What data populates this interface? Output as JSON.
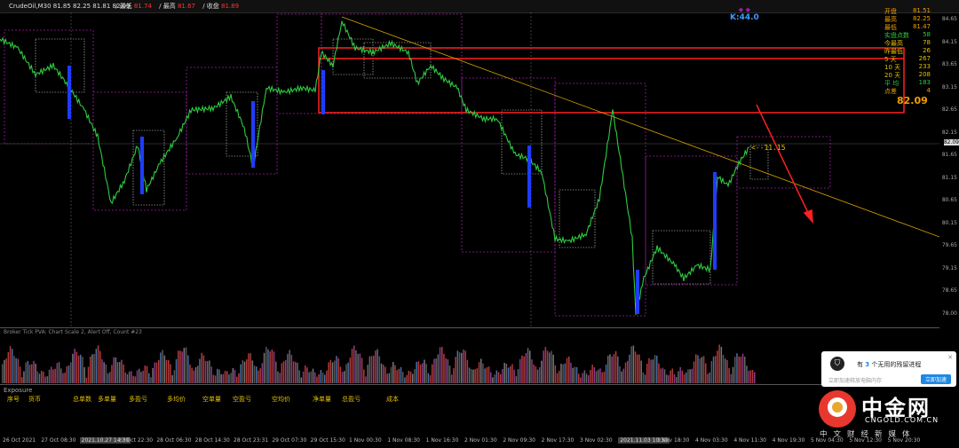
{
  "topbar": {
    "symbol": "CrudeOil,M30  81.85 82.25 81.81 82.09",
    "o_label": "/ 最低",
    "o_val": "81.74",
    "h_label": "/ 最高",
    "h_val": "81.67",
    "c_label": "/ 收盘",
    "c_val": "81.89"
  },
  "k_label": "K:44.0",
  "current_price_label": "82.09",
  "price_arrow_label": "<--11.15",
  "info_panel": {
    "rows": [
      {
        "label": "开盘",
        "value": "81.51",
        "color": "#f0a000"
      },
      {
        "label": "最高",
        "value": "82.25",
        "color": "#f0a000"
      },
      {
        "label": "最低",
        "value": "81.47",
        "color": "#f0a000"
      },
      {
        "label": "实盘点数",
        "value": "58",
        "color": "#2ecc40"
      },
      {
        "label": "今最高",
        "value": "78",
        "color": "#e5c100"
      },
      {
        "label": "昨最低",
        "value": "26",
        "color": "#e5c100"
      },
      {
        "label": "5  天",
        "value": "267",
        "color": "#e5c100"
      },
      {
        "label": "10 天",
        "value": "233",
        "color": "#e5c100"
      },
      {
        "label": "20 天",
        "value": "208",
        "color": "#e5c100"
      },
      {
        "label": "平  均",
        "value": "183",
        "color": "#2ecc40"
      },
      {
        "label": "点差",
        "value": "4",
        "color": "#f0a000"
      }
    ],
    "big_price": "82.09"
  },
  "price_axis": [
    "84.65",
    "84.15",
    "83.65",
    "83.15",
    "82.65",
    "82.15",
    "81.65",
    "81.15",
    "80.65",
    "80.15",
    "79.65",
    "79.15",
    "78.65",
    "78.00"
  ],
  "volume_label": "Broker Tick PVA:   Chart Scale  2, Alert Off,  Count  #23",
  "exposure": {
    "title": "Exposure",
    "columns": [
      "序号",
      "货币",
      "总单数",
      "多单量",
      "多盈亏",
      "多均价",
      "空单量",
      "空盈亏",
      "空均价",
      "净单量",
      "总盈亏",
      "成本"
    ]
  },
  "time_axis": [
    {
      "t": "26 Oct 2021",
      "hl": false
    },
    {
      "t": "27 Oct 08:30",
      "hl": false
    },
    {
      "t": "2021.10.27 14:30",
      "hl": true
    },
    {
      "t": "27 Oct 22:30",
      "hl": false
    },
    {
      "t": "28 Oct 06:30",
      "hl": false
    },
    {
      "t": "28 Oct 14:30",
      "hl": false
    },
    {
      "t": "28 Oct 23:31",
      "hl": false
    },
    {
      "t": "29 Oct 07:30",
      "hl": false
    },
    {
      "t": "29 Oct 15:30",
      "hl": false
    },
    {
      "t": "1 Nov 00:30",
      "hl": false
    },
    {
      "t": "1 Nov 08:30",
      "hl": false
    },
    {
      "t": "1 Nov 16:30",
      "hl": false
    },
    {
      "t": "2 Nov 01:30",
      "hl": false
    },
    {
      "t": "2 Nov 09:30",
      "hl": false
    },
    {
      "t": "2 Nov 17:30",
      "hl": false
    },
    {
      "t": "3 Nov 02:30",
      "hl": false
    },
    {
      "t": "2021.11.03 10:30",
      "hl": true
    },
    {
      "t": "3 Nov 18:30",
      "hl": false
    },
    {
      "t": "4 Nov 03:30",
      "hl": false
    },
    {
      "t": "4 Nov 11:30",
      "hl": false
    },
    {
      "t": "4 Nov 19:30",
      "hl": false
    },
    {
      "t": "5 Nov 04:30",
      "hl": false
    },
    {
      "t": "5 Nov 12:30",
      "hl": false
    },
    {
      "t": "5 Nov 20:30",
      "hl": false
    }
  ],
  "notification": {
    "msg_pre": "有 ",
    "msg_num": "3",
    "msg_post": " 个无用的残留进程",
    "sub": "立即加速释放电脑内存",
    "button": "立即加速"
  },
  "logo": {
    "cn": "中金网",
    "en": "CNGOLD.COM.CN",
    "sub": "中文财经新媒体"
  }
}
